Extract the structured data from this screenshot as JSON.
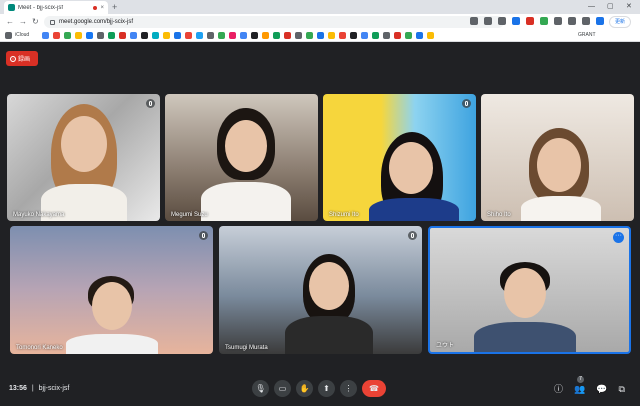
{
  "browser": {
    "tab_title": "Meet - bjj-scix-jsf",
    "tab_close": "×",
    "new_tab": "+",
    "url": "meet.google.com/bjj-scix-jsf",
    "update_label": "更新",
    "bookmark_first": "iCloud",
    "bookmark_last": "GRANT",
    "window_controls": [
      "—",
      "▢",
      "✕"
    ]
  },
  "meet": {
    "recording_label": "録画",
    "time": "13:56",
    "meeting_code": "bjj-scix-jsf",
    "participant_count": "7",
    "colors": {
      "background": "#202124",
      "end_call": "#ea4335",
      "active_speaker": "#1a73e8",
      "recording": "#d93025"
    },
    "participants": [
      {
        "name": "Mayuko Nakayama",
        "muted": true
      },
      {
        "name": "Megumi Suzu",
        "muted": false
      },
      {
        "name": "Shizumi Ito",
        "muted": true
      },
      {
        "name": "Shiho Ito",
        "muted": false
      },
      {
        "name": "Tomonori Kaneko",
        "muted": true
      },
      {
        "name": "Tsumugi Murata",
        "muted": true
      },
      {
        "name": "ユウト",
        "muted": false
      }
    ],
    "controls": {
      "mic_icon": "🎙",
      "camera_icon": "▭",
      "hand_icon": "✋",
      "present_icon": "⬆",
      "more_icon": "⋮",
      "end_icon": "☎",
      "info_icon": "ⓘ",
      "people_icon": "👥",
      "chat_icon": "💬",
      "activities_icon": "⧉"
    }
  }
}
